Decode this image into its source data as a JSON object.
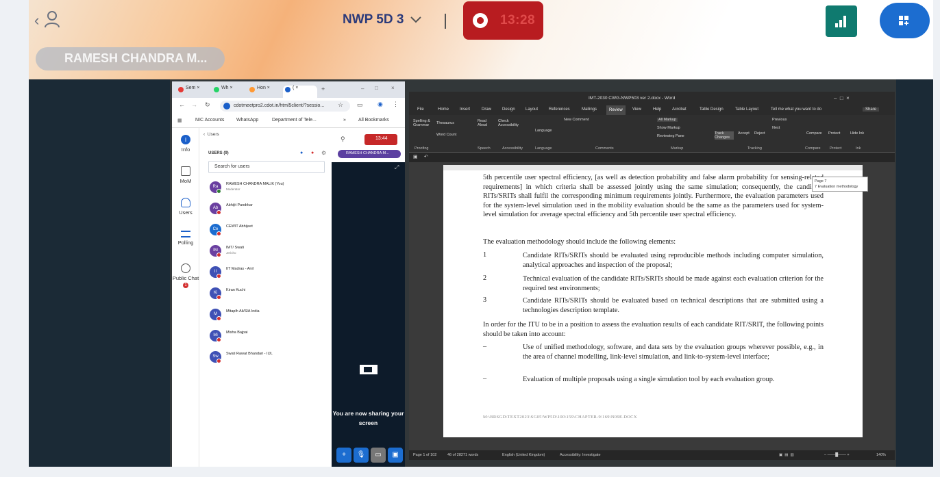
{
  "meeting": {
    "title": "NWP 5D 3",
    "recording_time": "13:28",
    "presenter": "RAMESH CHANDRA M..."
  },
  "colors": {
    "record": "#b81c20",
    "stats": "#0f7a6f",
    "apps": "#1c6dd0",
    "title": "#2b3a7a"
  },
  "icons": {
    "back": "chevron-left-icon",
    "user": "user-icon",
    "title_dropdown": "chevron-down-icon",
    "record": "record-icon",
    "stats": "bar-chart-icon",
    "apps": "apps-plus-icon"
  },
  "browser": {
    "tabs": [
      {
        "label": "Sem",
        "color": "#e53935"
      },
      {
        "label": "Wh",
        "color": "#25d366"
      },
      {
        "label": "Hon",
        "color": "#ff9933"
      },
      {
        "label": "(",
        "color": "#1a5fc9"
      }
    ],
    "url": "cdotmeetpro2.cdot.in/html5client/?sessio...",
    "bookmarks": [
      "NIC Accounts",
      "WhatsApp",
      "Department of Tele...",
      "All Bookmarks"
    ]
  },
  "app_sidebar": [
    {
      "label": "Info",
      "icon": "info-icon"
    },
    {
      "label": "MoM",
      "icon": "document-icon"
    },
    {
      "label": "Users",
      "icon": "users-icon"
    },
    {
      "label": "Polling",
      "icon": "list-icon"
    },
    {
      "label": "Public Chat",
      "icon": "chat-icon",
      "badge": "1"
    }
  ],
  "users_panel": {
    "back_label": "Users",
    "count_label": "USERS (9)",
    "search_placeholder": "Search for users",
    "users": [
      {
        "initials": "Ra",
        "name": "RAMESH CHANDRA MALIK (You)",
        "role": "Moderator",
        "color": "#6a3fa0"
      },
      {
        "initials": "Ab",
        "name": "Abhijit Pandrkar",
        "role": "",
        "color": "#6a3fa0"
      },
      {
        "initials": "Ce",
        "name": "CEWIT Abhijeet",
        "role": "",
        "color": "#1c6dd0"
      },
      {
        "initials": "IM",
        "name": "IMT/ Swati",
        "role": "Jericho",
        "color": "#6a3fa0"
      },
      {
        "initials": "II",
        "name": "IIT Madras - Anil",
        "role": "",
        "color": "#3f51b5"
      },
      {
        "initials": "Ki",
        "name": "Kiran Kuchi",
        "role": "",
        "color": "#3f51b5"
      },
      {
        "initials": "M",
        "name": "Mitaplh Ali/SIA India",
        "role": "",
        "color": "#3f51b5"
      },
      {
        "initials": "Mi",
        "name": "Misha Bajpai",
        "role": "",
        "color": "#3f51b5"
      },
      {
        "initials": "Sw",
        "name": "Swati Rawat Bhandari - IIJL",
        "role": "",
        "color": "#3f51b5"
      }
    ]
  },
  "mini_controls": {
    "record_time": "13:44",
    "presenter_label": "RAMESH CHANDRA M...",
    "share_message": "You are now sharing your screen"
  },
  "word": {
    "title": "IMT-2030  CWG-NWP503 ver 2.docx  -  Word",
    "menu": [
      "File",
      "Home",
      "Insert",
      "Draw",
      "Design",
      "Layout",
      "References",
      "Mailings",
      "Review",
      "View",
      "Help",
      "Acrobat",
      "Table Design",
      "Table Layout",
      "Tell me what you want to do"
    ],
    "active_menu": "Review",
    "share_btn": "Share",
    "ribbon_groups": [
      "Proofing",
      "Speech",
      "Accessibility",
      "Language",
      "Comments",
      "Markup",
      "Tracking",
      "Compare",
      "Protect",
      "Ink"
    ],
    "ribbon_labels": {
      "spelling": "Spelling & Grammar",
      "thesaurus": "Thesaurus",
      "word_count": "Word Count",
      "read_aloud": "Read Aloud",
      "check_access": "Check Accessibility",
      "language": "Language",
      "new_comment": "New Comment",
      "all_markup": "All Markup",
      "show_markup": "Show Markup",
      "reviewing_pane": "Reviewing Pane",
      "track_changes": "Track Changes",
      "accept": "Accept",
      "reject": "Reject",
      "previous": "Previous",
      "next": "Next",
      "compare": "Compare",
      "protect": "Protect",
      "hide_ink": "Hide Ink"
    },
    "comment_popup": [
      "Page 7",
      "7 Evaluation methodology"
    ],
    "doc": {
      "para1": "5th percentile user spectral efficiency, [as well as detection probability and false alarm probability for sensing-related requirements] in which criteria shall be assessed jointly using the same simulation; consequently, the candidate RITs/SRITs shall fulfil the corresponding minimum requirements jointly. Furthermore, the evaluation parameters used for the system-level simulation used in the mobility evaluation should be the same as the parameters used for system-level simulation for average spectral efficiency and 5th percentile user spectral efficiency.",
      "para2": "The evaluation methodology should include the following elements:",
      "items": [
        {
          "num": "1",
          "text": "Candidate RITs/SRITs should be evaluated using reproducible methods including computer simulation, analytical approaches and inspection of the proposal;"
        },
        {
          "num": "2",
          "text": "Technical evaluation of the candidate RITs/SRITs should be made against each evaluation criterion for the required test environments;"
        },
        {
          "num": "3",
          "text": "Candidate RITs/SRITs should be evaluated based on technical descriptions that are submitted using a technologies description template."
        }
      ],
      "para3": "In order for the ITU to be in a position to assess the evaluation results of each candidate RIT/SRIT, the following points should be taken into account:",
      "bullets": [
        {
          "dash": "–",
          "text": "Use of unified methodology, software, and data sets by the evaluation groups wherever possible, e.g., in the area of channel modelling, link-level simulation, and link-to-system-level interface;"
        },
        {
          "dash": "–",
          "text": "Evaluation of multiple proposals using a single simulation tool by each evaluation group."
        }
      ],
      "footer": "M:\\BRSGD\\TEXT2023\\SG05\\WP5D\\100\\159\\CHAPTER-9\\169\\N09E.DOCX"
    },
    "status": {
      "page": "Page 1 of 102",
      "words": "46 of 28271 words",
      "language": "English (United Kingdom)",
      "accessibility": "Accessibility: Investigate",
      "zoom": "140%"
    }
  }
}
